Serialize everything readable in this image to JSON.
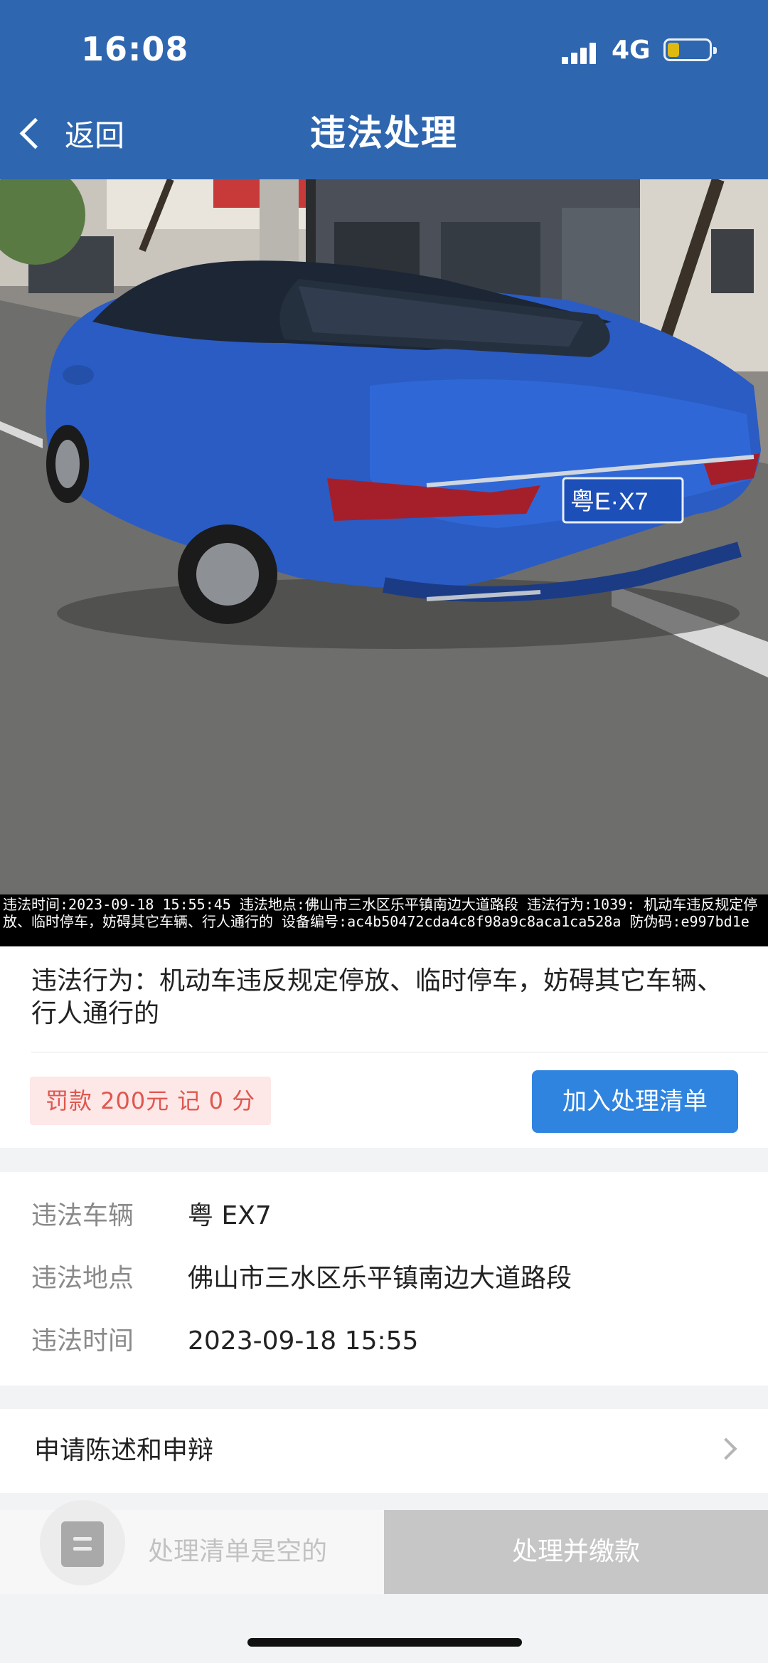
{
  "status_bar": {
    "time": "16:08",
    "network": "4G"
  },
  "nav": {
    "back_label": "返回",
    "title": "违法处理"
  },
  "photo": {
    "plate_text": "粤E·X7",
    "overlay_text": "违法时间:2023-09-18 15:55:45 违法地点:佛山市三水区乐平镇南边大道路段 违法行为:1039: 机动车违反规定停放、临时停车，妨碍其它车辆、行人通行的 设备编号:ac4b50472cda4c8f98a9c8aca1ca528a 防伪码:e997bd1e"
  },
  "violation": {
    "behavior": "违法行为：机动车违反规定停放、临时停车，妨碍其它车辆、行人通行的",
    "fine_tag": "罚款 200元  记 0 分",
    "add_button": "加入处理清单"
  },
  "details": [
    {
      "label": "违法车辆",
      "value": "粤 EX7"
    },
    {
      "label": "违法地点",
      "value": "佛山市三水区乐平镇南边大道路段"
    },
    {
      "label": "违法时间",
      "value": "2023-09-18 15:55"
    }
  ],
  "statement": {
    "label": "申请陈述和申辩"
  },
  "bottom_bar": {
    "empty_text": "处理清单是空的",
    "pay_button": "处理并缴款"
  },
  "colors": {
    "header": "#2f66b0",
    "primary_button": "#2f84e0",
    "fine_text": "#e0574f",
    "fine_bg": "#fde7e7"
  }
}
